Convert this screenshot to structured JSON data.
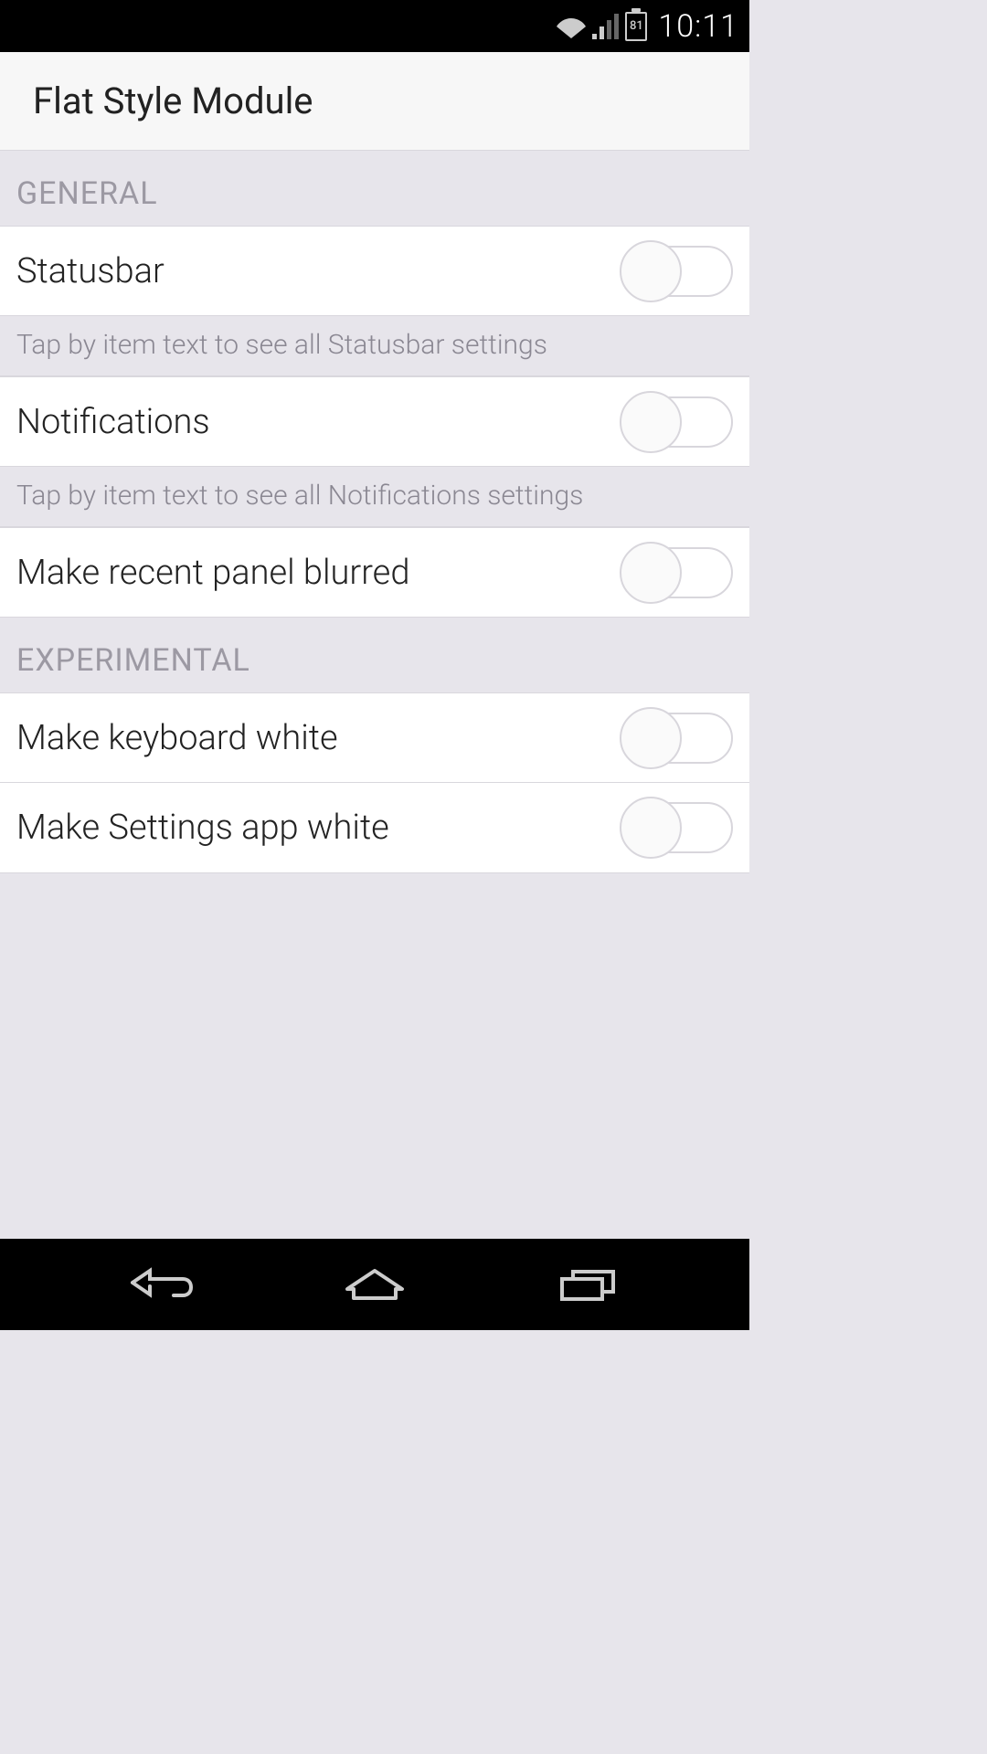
{
  "status_bar": {
    "time": "10:11",
    "battery": "81"
  },
  "header": {
    "title": "Flat Style Module"
  },
  "sections": {
    "general": {
      "title": "GENERAL",
      "items": {
        "statusbar": {
          "label": "Statusbar",
          "hint": "Tap by item text to see all Statusbar settings"
        },
        "notifications": {
          "label": "Notifications",
          "hint": "Tap by item text to see all Notifications settings"
        },
        "recent_panel": {
          "label": "Make recent panel blurred"
        }
      }
    },
    "experimental": {
      "title": "EXPERIMENTAL",
      "items": {
        "keyboard_white": {
          "label": "Make keyboard white"
        },
        "settings_white": {
          "label": "Make Settings app white"
        }
      }
    }
  }
}
